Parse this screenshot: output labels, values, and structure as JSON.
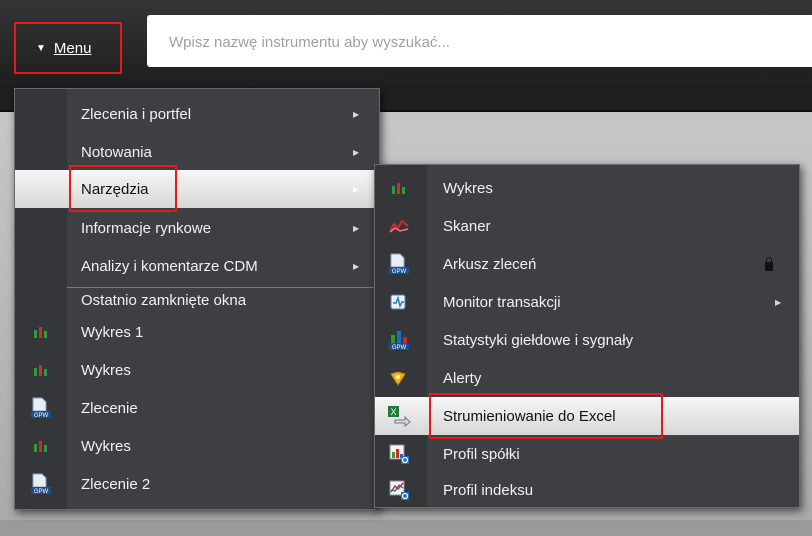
{
  "header": {
    "menu_label": "Menu",
    "search_placeholder": "Wpisz nazwę instrumentu aby wyszukać..."
  },
  "main_menu": {
    "items": [
      {
        "label": "Zlecenia i portfel",
        "submenu": true
      },
      {
        "label": "Notowania",
        "submenu": true
      },
      {
        "label": "Narzędzia",
        "submenu": true,
        "selected": true
      },
      {
        "label": "Informacje rynkowe",
        "submenu": true
      },
      {
        "label": "Analizy i komentarze CDM",
        "submenu": true
      }
    ],
    "recent_header": "Ostatnio zamknięte okna",
    "recent": [
      {
        "label": "Wykres 1",
        "icon": "chart-icon"
      },
      {
        "label": "Wykres",
        "icon": "chart-icon"
      },
      {
        "label": "Zlecenie",
        "icon": "gpw-document-icon"
      },
      {
        "label": "Wykres",
        "icon": "chart-icon"
      },
      {
        "label": "Zlecenie 2",
        "icon": "gpw-document-icon"
      }
    ]
  },
  "tools_menu": {
    "items": [
      {
        "label": "Wykres",
        "icon": "chart-icon"
      },
      {
        "label": "Skaner",
        "icon": "scanner-icon"
      },
      {
        "label": "Arkusz zleceń",
        "icon": "gpw-document-icon",
        "locked": true
      },
      {
        "label": "Monitor transakcji",
        "icon": "monitor-icon",
        "submenu": true
      },
      {
        "label": "Statystyki giełdowe i sygnały",
        "icon": "gpw-stats-icon"
      },
      {
        "label": "Alerty",
        "icon": "alert-bell-icon"
      },
      {
        "label": "Strumieniowanie do Excel",
        "icon": "excel-stream-icon",
        "selected": true
      },
      {
        "label": "Profil spółki",
        "icon": "company-profile-icon"
      },
      {
        "label": "Profil indeksu",
        "icon": "index-profile-icon"
      }
    ]
  },
  "colors": {
    "highlight_border": "#e41b1b",
    "menu_bg": "#3d3f42",
    "selected_bg": "#e6e6e6"
  }
}
